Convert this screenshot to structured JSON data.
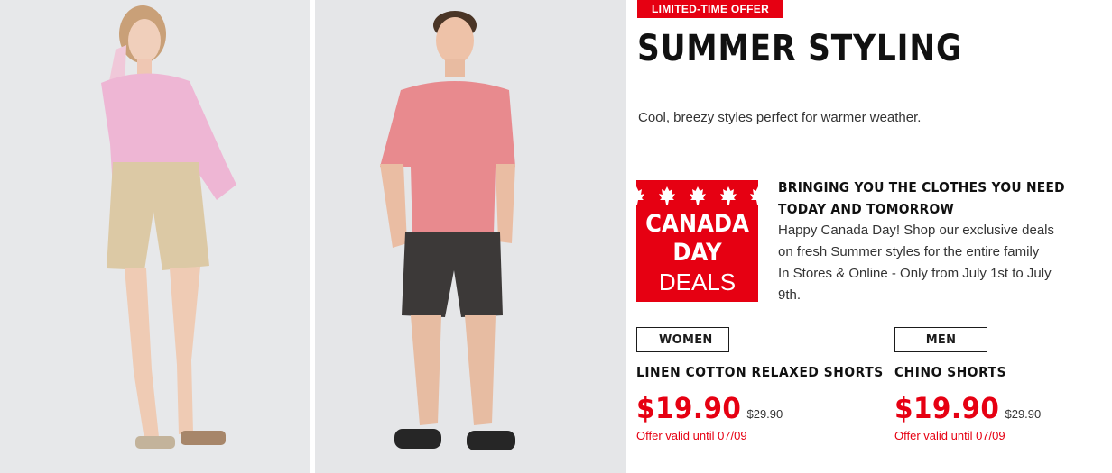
{
  "hero": {
    "badge": "LIMITED-TIME OFFER",
    "title": "SUMMER STYLING",
    "subtitle": "Cool, breezy styles perfect for warmer weather."
  },
  "promo": {
    "badge_line1": "CANADA",
    "badge_line2": "DAY",
    "badge_line3": "DEALS",
    "heading_line1": "BRINGING YOU THE CLOTHES YOU NEED",
    "heading_line2": "TODAY AND TOMORROW",
    "body_line1": "Happy Canada Day! Shop our exclusive deals",
    "body_line2": "on fresh Summer styles for the entire family",
    "body_line3": "In Stores & Online - Only from July 1st to July",
    "body_line4": "9th."
  },
  "products": [
    {
      "gender": "WOMEN",
      "name": "LINEN COTTON RELAXED SHORTS",
      "price": "$19.90",
      "old_price": "$29.90",
      "offer": "Offer valid until 07/09"
    },
    {
      "gender": "MEN",
      "name": "CHINO SHORTS",
      "price": "$19.90",
      "old_price": "$29.90",
      "offer": "Offer valid until 07/09"
    }
  ],
  "colors": {
    "brand_red": "#e60012",
    "text_dark": "#1b1b1b"
  }
}
